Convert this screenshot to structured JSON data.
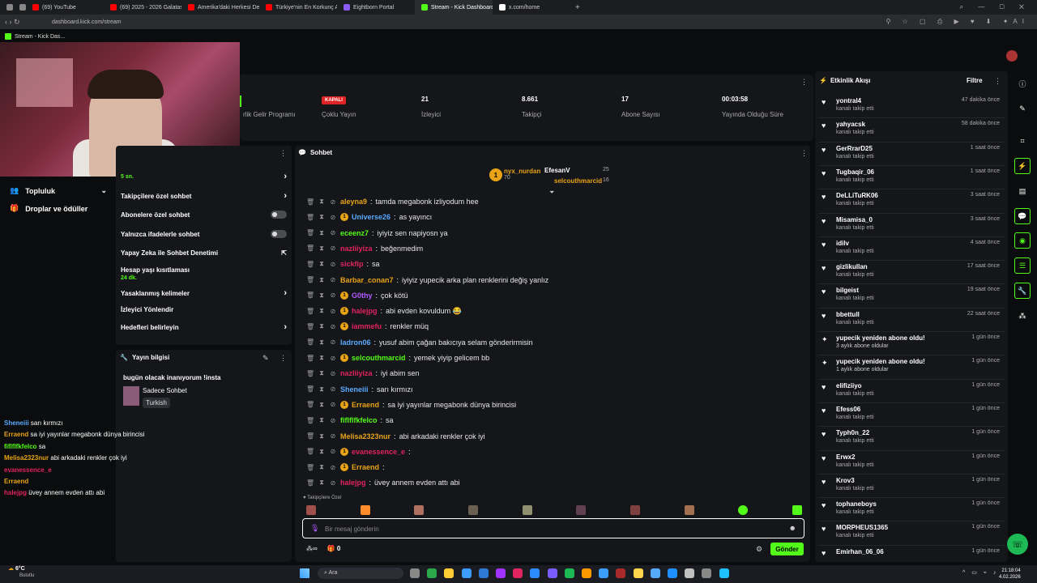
{
  "browser": {
    "tabs": [
      {
        "label": "",
        "color": "#888"
      },
      {
        "label": "",
        "color": "#888"
      },
      {
        "label": "(69) YouTube",
        "color": "#ff0000"
      },
      {
        "label": "(69) 2025 - 2026 Galatasa",
        "color": "#ff0000"
      },
      {
        "label": "Amerika'daki Herkesi Dee",
        "color": "#ff0000"
      },
      {
        "label": "Türkiye'nin En Korkunç Al",
        "color": "#ff0000"
      },
      {
        "label": "Eightborn Portal",
        "color": "#8a5cf6"
      },
      {
        "label": "Stream - Kick Dashboard",
        "color": "#53fc18"
      },
      {
        "label": "x.com/home",
        "color": "#ffffff"
      }
    ],
    "url": "dashboard.kick.com/stream",
    "page_title": "Stream - Kick Das..."
  },
  "stats": {
    "income_program": "rlik Gelir Programı",
    "status_badge": "KAPALI",
    "multi_stream": "Çoklu Yayın",
    "viewers": "21",
    "viewers_label": "İzleyici",
    "followers": "8.661",
    "followers_label": "Takipçi",
    "subs": "17",
    "subs_label": "Abone Sayısı",
    "uptime": "00:03:58",
    "uptime_label": "Yayında Olduğu Süre"
  },
  "sidebar": {
    "community": "Topluluk",
    "drops": "Droplar ve ödüller"
  },
  "chat_settings": {
    "slow_label": "5 sn.",
    "followers_only": "Takipçilere özel sohbet",
    "subscribers_only": "Abonelere özel sohbet",
    "emotes_only": "Yalnızca ifadelerle sohbet",
    "ai_moderation": "Yapay Zeka ile Sohbet Denetimi",
    "account_age": "Hesap yaşı kısıtlaması",
    "account_age_value": "24 dk.",
    "banned_words": "Yasaklanmış kelimeler",
    "redirect": "İzleyici Yönlendir",
    "goals": "Hedefleri belirleyin"
  },
  "stream_info": {
    "header": "Yayın bilgisi",
    "title": "bugün olacak inanıyorum !insta",
    "category": "Sadece Sohbet",
    "language": "Turkish"
  },
  "chat": {
    "header": "Sohbet",
    "leaders": [
      {
        "name": "nyx_nurdan",
        "count": "70",
        "color": "#e8a317"
      },
      {
        "name": "EfesanV",
        "count": "25",
        "color": "#ffffff"
      },
      {
        "name": "selcouthmarcid",
        "count": "16",
        "color": "#e8a317"
      }
    ],
    "messages": [
      {
        "user": "aleyna9",
        "color": "#e8a317",
        "text": "tamda megabonk izliyodum hee"
      },
      {
        "user": "Universe26",
        "color": "#5aa9ff",
        "text": "as yayıncı"
      },
      {
        "user": "eceenz7",
        "color": "#53fc18",
        "text": "iyiyiz sen napiyosn ya"
      },
      {
        "user": "nazliiyiza",
        "color": "#e0245e",
        "text": "beğenmedim"
      },
      {
        "user": "sickfip",
        "color": "#e0245e",
        "text": "sa"
      },
      {
        "user": "Barbar_conan7",
        "color": "#e8a317",
        "text": "iyiyiz yupecik arka plan renklerini değiş yanlız"
      },
      {
        "user": "G0thy",
        "color": "#b05cff",
        "text": "çok kötü"
      },
      {
        "user": "halejpg",
        "color": "#e0245e",
        "text": "abi evden kovuldum 😂"
      },
      {
        "user": "iammefu",
        "color": "#e0245e",
        "text": "renkler müq"
      },
      {
        "user": "ladron06",
        "color": "#5aa9ff",
        "text": "yusuf abim çağan bakıcıya selam gönderirmisin"
      },
      {
        "user": "selcouthmarcid",
        "color": "#53fc18",
        "text": "yemek yiyip gelicem bb"
      },
      {
        "user": "nazliiyiza",
        "color": "#e0245e",
        "text": "iyi abim sen"
      },
      {
        "user": "Sheneiii",
        "color": "#5aa9ff",
        "text": "sarı kırmızı"
      },
      {
        "user": "Erraend",
        "color": "#e8a317",
        "text": "sa iyi yayınlar megabonk dünya birincisi"
      },
      {
        "user": "fiflflfkfelco",
        "color": "#53fc18",
        "text": "sa"
      },
      {
        "user": "Melisa2323nur",
        "color": "#e8a317",
        "text": "abi arkadaki renkler çok iyi"
      },
      {
        "user": "evanessence_e",
        "color": "#e0245e",
        "text": ""
      },
      {
        "user": "Erraend",
        "color": "#e8a317",
        "text": ""
      },
      {
        "user": "halejpg",
        "color": "#e0245e",
        "text": "üvey annem evden attı abi"
      }
    ],
    "followers_only_label": "Takipçilere Özel",
    "input_placeholder": "Bir mesaj gönderin",
    "send_label": "Gönder",
    "counter": "0"
  },
  "overlay_chat": [
    {
      "user": "Sheneiii",
      "color": "#5aa9ff",
      "text": "sarı kırmızı"
    },
    {
      "user": "Erraend",
      "color": "#e8a317",
      "text": "sa iyi yayınlar megabonk dünya birincisi"
    },
    {
      "user": "fiflflfkfelco",
      "color": "#53fc18",
      "text": "sa"
    },
    {
      "user": "Melisa2323nur",
      "color": "#e8a317",
      "text": "abi arkadaki renkler çok iyi"
    },
    {
      "user": "evanessence_e",
      "color": "#e0245e",
      "text": ""
    },
    {
      "user": "Erraend",
      "color": "#e8a317",
      "text": ""
    },
    {
      "user": "halejpg",
      "color": "#e0245e",
      "text": "üvey annem evden attı abi"
    }
  ],
  "activity": {
    "header": "Etkinlik Akışı",
    "filter": "Filtre",
    "items": [
      {
        "name": "yontral4",
        "sub": "kanalı takip etti",
        "time": "47 dakika önce",
        "kind": "follow"
      },
      {
        "name": "yahyacsk",
        "sub": "kanalı takip etti",
        "time": "58 dakika önce",
        "kind": "follow"
      },
      {
        "name": "GerRrarD25",
        "sub": "kanalı takip etti",
        "time": "1 saat önce",
        "kind": "follow"
      },
      {
        "name": "Tugbaqir_06",
        "sub": "kanalı takip etti",
        "time": "1 saat önce",
        "kind": "follow"
      },
      {
        "name": "DeLLiTuRK06",
        "sub": "kanalı takip etti",
        "time": "3 saat önce",
        "kind": "follow"
      },
      {
        "name": "Misamisa_0",
        "sub": "kanalı takip etti",
        "time": "3 saat önce",
        "kind": "follow"
      },
      {
        "name": "idilv",
        "sub": "kanalı takip etti",
        "time": "4 saat önce",
        "kind": "follow"
      },
      {
        "name": "gizlikullan",
        "sub": "kanalı takip etti",
        "time": "17 saat önce",
        "kind": "follow"
      },
      {
        "name": "bilgeist",
        "sub": "kanalı takip etti",
        "time": "19 saat önce",
        "kind": "follow"
      },
      {
        "name": "bbettull",
        "sub": "kanalı takip etti",
        "time": "22 saat önce",
        "kind": "follow"
      },
      {
        "name": "yupecik yeniden abone oldu!",
        "sub": "3 aylık abone oldular",
        "time": "1 gün önce",
        "kind": "sub"
      },
      {
        "name": "yupecik yeniden abone oldu!",
        "sub": "1 aylık abone oldular",
        "time": "1 gün önce",
        "kind": "sub"
      },
      {
        "name": "elifiziiyo",
        "sub": "kanalı takip etti",
        "time": "1 gün önce",
        "kind": "follow"
      },
      {
        "name": "Efess06",
        "sub": "kanalı takip etti",
        "time": "1 gün önce",
        "kind": "follow"
      },
      {
        "name": "Typh0n_22",
        "sub": "kanalı takip etti",
        "time": "1 gün önce",
        "kind": "follow"
      },
      {
        "name": "Erwx2",
        "sub": "kanalı takip etti",
        "time": "1 gün önce",
        "kind": "follow"
      },
      {
        "name": "Krov3",
        "sub": "kanalı takip etti",
        "time": "1 gün önce",
        "kind": "follow"
      },
      {
        "name": "tophaneboys",
        "sub": "kanalı takip etti",
        "time": "1 gün önce",
        "kind": "follow"
      },
      {
        "name": "MORPHEUS1365",
        "sub": "kanalı takip etti",
        "time": "1 gün önce",
        "kind": "follow"
      },
      {
        "name": "Emirhan_06_06",
        "sub": "",
        "time": "1 gün önce",
        "kind": "follow"
      }
    ]
  },
  "taskbar": {
    "weather_temp": "6°C",
    "weather_desc": "Bulutlu",
    "search": "Ara",
    "time": "21:18:04",
    "date": "4.02.2026"
  },
  "colors": {
    "accent": "#53fc18",
    "bg": "#0b0c0d",
    "panel": "#15161a"
  }
}
